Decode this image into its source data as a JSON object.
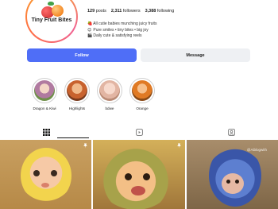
{
  "profile": {
    "brand_name": "Tiny Fruit Bites",
    "stats": [
      {
        "value": "129",
        "label": "posts"
      },
      {
        "value": "2,311",
        "label": "followers"
      },
      {
        "value": "3,388",
        "label": "following"
      }
    ],
    "bio": [
      {
        "icon": "🍓",
        "icon_name": "strawberry-icon",
        "text": "All cutie babies munching juicy fruits"
      },
      {
        "icon": "😊",
        "icon_name": "smile-icon",
        "text": "Pure smiles • tiny bites • big joy"
      },
      {
        "icon": "🎬",
        "icon_name": "clapper-icon",
        "text": "Daily cute & satisfying reels"
      }
    ]
  },
  "actions": {
    "follow_label": "Follow",
    "message_label": "Message"
  },
  "highlights": [
    {
      "label": "Dragon & Kiwi",
      "color": "#c8a2b6"
    },
    {
      "label": "Highlights",
      "color": "#c86a3a"
    },
    {
      "label": "bdwe",
      "color": "#e8c2b2"
    },
    {
      "label": "Orange",
      "color": "#d97a2c"
    }
  ],
  "tabs": [
    {
      "name": "grid-icon",
      "active": true
    },
    {
      "name": "reels-icon",
      "active": false
    },
    {
      "name": "tagged-icon",
      "active": false
    }
  ],
  "posts": {
    "watermark": "@Aiblogwith"
  },
  "colors": {
    "accent": "#4f6ef7",
    "secondary_button": "#eef0f3"
  }
}
